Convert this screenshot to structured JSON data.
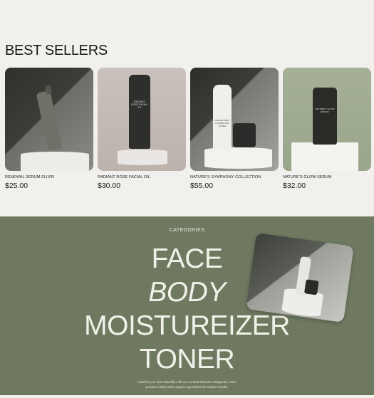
{
  "best_sellers": {
    "title": "BEST SELLERS",
    "products": [
      {
        "name": "RENEWAL SERUM ELIXIR",
        "price": "$25.00",
        "label": ""
      },
      {
        "name": "RADIANT ROSE FACIAL OIL",
        "price": "$30.00",
        "label": "RADIANT ROSE FACIAL OIL"
      },
      {
        "name": "NATURE'S SYMPHONY COLLECTION",
        "price": "$55.00",
        "label": "FLORAL MIST HYDRATING TONER"
      },
      {
        "name": "NATURE'S GLOW SERUM",
        "price": "$32.00",
        "label": "NATURE'S GLOW SERUM"
      }
    ]
  },
  "categories": {
    "eyebrow": "CATEGORIES",
    "items": [
      "FACE",
      "BODY",
      "MOISTUREIZER",
      "TONER"
    ],
    "description_line1": "Nourish your skin naturally with our curated skincare categories, each",
    "description_line2": "product crafted with organic ingredients for radiant results."
  },
  "colors": {
    "page_bg": "#f1f0ec",
    "categories_bg": "#6f7960",
    "category_text": "#f1f1ea"
  }
}
